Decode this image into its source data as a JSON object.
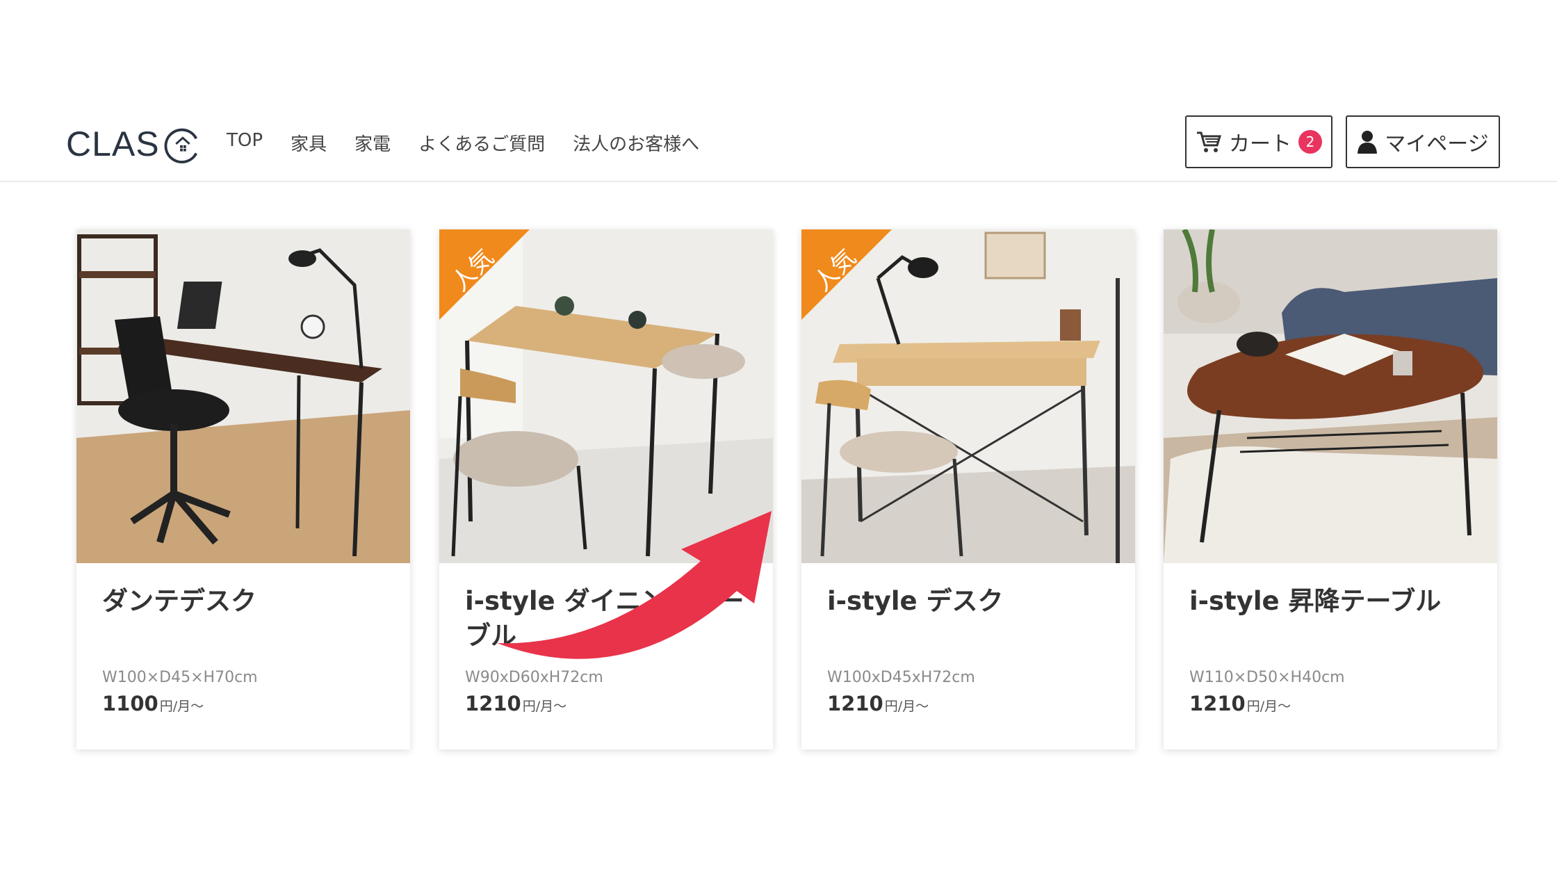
{
  "header": {
    "logo_text": "CLAS",
    "nav": [
      "TOP",
      "家具",
      "家電",
      "よくあるご質問",
      "法人のお客様へ"
    ],
    "cart": {
      "label": "カート",
      "count": "2"
    },
    "mypage": {
      "label": "マイページ"
    }
  },
  "products": [
    {
      "title": "ダンテデスク",
      "size": "W100×D45×H70cm",
      "price": "1100",
      "unit": "円/月〜",
      "badge": ""
    },
    {
      "title": "i-style ダイニングテーブル",
      "size": "W90xD60xH72cm",
      "price": "1210",
      "unit": "円/月〜",
      "badge": "人気"
    },
    {
      "title": "i-style デスク",
      "size": "W100xD45xH72cm",
      "price": "1210",
      "unit": "円/月〜",
      "badge": "人気"
    },
    {
      "title": "i-style 昇降テーブル",
      "size": "W110×D50×H40cm",
      "price": "1210",
      "unit": "円/月〜",
      "badge": ""
    }
  ],
  "colors": {
    "badge": "#f08a1c",
    "cart_badge": "#e8345e",
    "arrow": "#e8334a"
  },
  "icons": {
    "cart": "cart-icon",
    "user": "user-icon",
    "arrow": "curved-arrow-annotation"
  }
}
